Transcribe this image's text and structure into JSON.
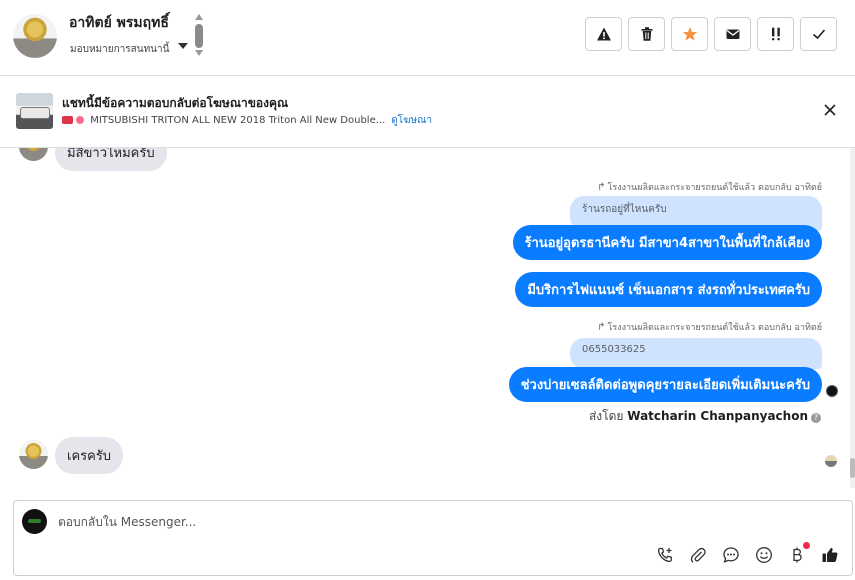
{
  "header": {
    "name": "อาทิตย์ พรมฤทธิ์",
    "assigned": "มอบหมายการสนทนานี้",
    "actions": [
      {
        "name": "report-spam-button",
        "icon": "warning-icon"
      },
      {
        "name": "delete-button",
        "icon": "trash-icon"
      },
      {
        "name": "star-button",
        "icon": "star-icon"
      },
      {
        "name": "mark-unread-button",
        "icon": "envelope-icon"
      },
      {
        "name": "follow-up-button",
        "icon": "exclamation-icon"
      },
      {
        "name": "done-button",
        "icon": "check-icon"
      }
    ],
    "star_color": "#f7923a"
  },
  "ad": {
    "title": "แชทนี้มีข้อความตอบกลับต่อโฆษณาของคุณ",
    "description": "MITSUBISHI TRITON ALL NEW 2018 Triton All New Double...",
    "link": "ดูโฆษณา"
  },
  "messages": {
    "incoming_top": "มีสีขาวไหมครับ",
    "reply_meta_1": "โรงงานผลิตและกระจายรถยนต์ใช้แล้ว ตอบกลับ อาทิตย์",
    "quote_1": "ร้านรถอยู่ที่ไหนครับ",
    "out_1": "ร้านอยู่อุดรธานีครับ มีสาขา4สาขาในพื้นที่ใกล้เคียง",
    "out_2": "มีบริการไฟแนนซ์ เซ็นเอกสาร ส่งรถทั่วประเทศครับ",
    "reply_meta_2": "โรงงานผลิตและกระจายรถยนต์ใช้แล้ว ตอบกลับ อาทิตย์",
    "quote_2": "0655033625",
    "out_3": "ช่วงบ่ายเซลล์ติดต่อพูดคุยรายละเอียดเพิ่มเติมนะครับ",
    "sent_by_prefix": "ส่งโดย",
    "sent_by_name": "Watcharin Chanpanyachon",
    "incoming_bottom": "เครครับ"
  },
  "composer": {
    "placeholder": "ตอบกลับใน Messenger...",
    "tools": [
      "call-icon",
      "attachment-icon",
      "saved-reply-icon",
      "emoji-icon",
      "payment-icon",
      "like-icon"
    ]
  },
  "colors": {
    "outgoing": "#0a7cff",
    "incoming": "#e4e6eb",
    "quote": "#cfe3ff",
    "link": "#1a73c8"
  }
}
